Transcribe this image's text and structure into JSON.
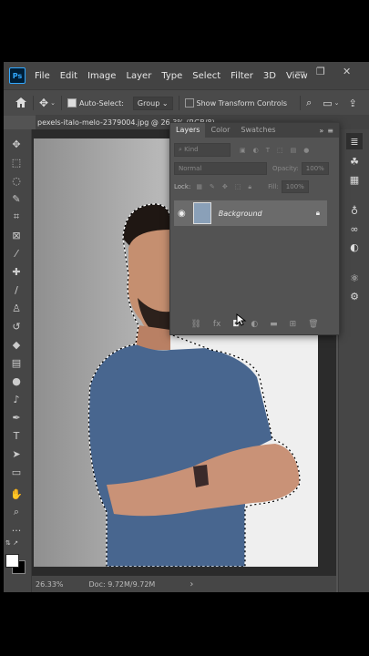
{
  "app": {
    "logo": "Ps"
  },
  "menu": [
    "File",
    "Edit",
    "Image",
    "Layer",
    "Type",
    "Select",
    "Filter",
    "3D",
    "View"
  ],
  "window_controls": {
    "minimize": "—",
    "restore": "❐",
    "close": "✕"
  },
  "options": {
    "home_icon": "home-icon",
    "auto_select_label": "Auto-Select:",
    "auto_select_checked": true,
    "auto_select_target": "Group",
    "show_transform_label": "Show Transform Controls",
    "show_transform_checked": false
  },
  "document": {
    "tab_title": "pexels-italo-melo-2379004.jpg @ 26.3% (RGB/8)"
  },
  "status": {
    "zoom": "26.33%",
    "doc": "Doc: 9.72M/9.72M",
    "arrow": "›"
  },
  "layers_panel": {
    "tabs": [
      "Layers",
      "Color",
      "Swatches"
    ],
    "filter_placeholder": "Kind",
    "blend_mode": "Normal",
    "opacity_label": "Opacity:",
    "opacity_value": "100%",
    "lock_label": "Lock:",
    "fill_label": "Fill:",
    "fill_value": "100%",
    "layers": [
      {
        "name": "Background",
        "visible": true,
        "locked": true
      }
    ],
    "bottom_icons": [
      "link-icon",
      "fx-icon",
      "add-mask-icon",
      "adjustment-icon",
      "group-icon",
      "new-layer-icon",
      "trash-icon"
    ],
    "fx_label": "fx"
  }
}
